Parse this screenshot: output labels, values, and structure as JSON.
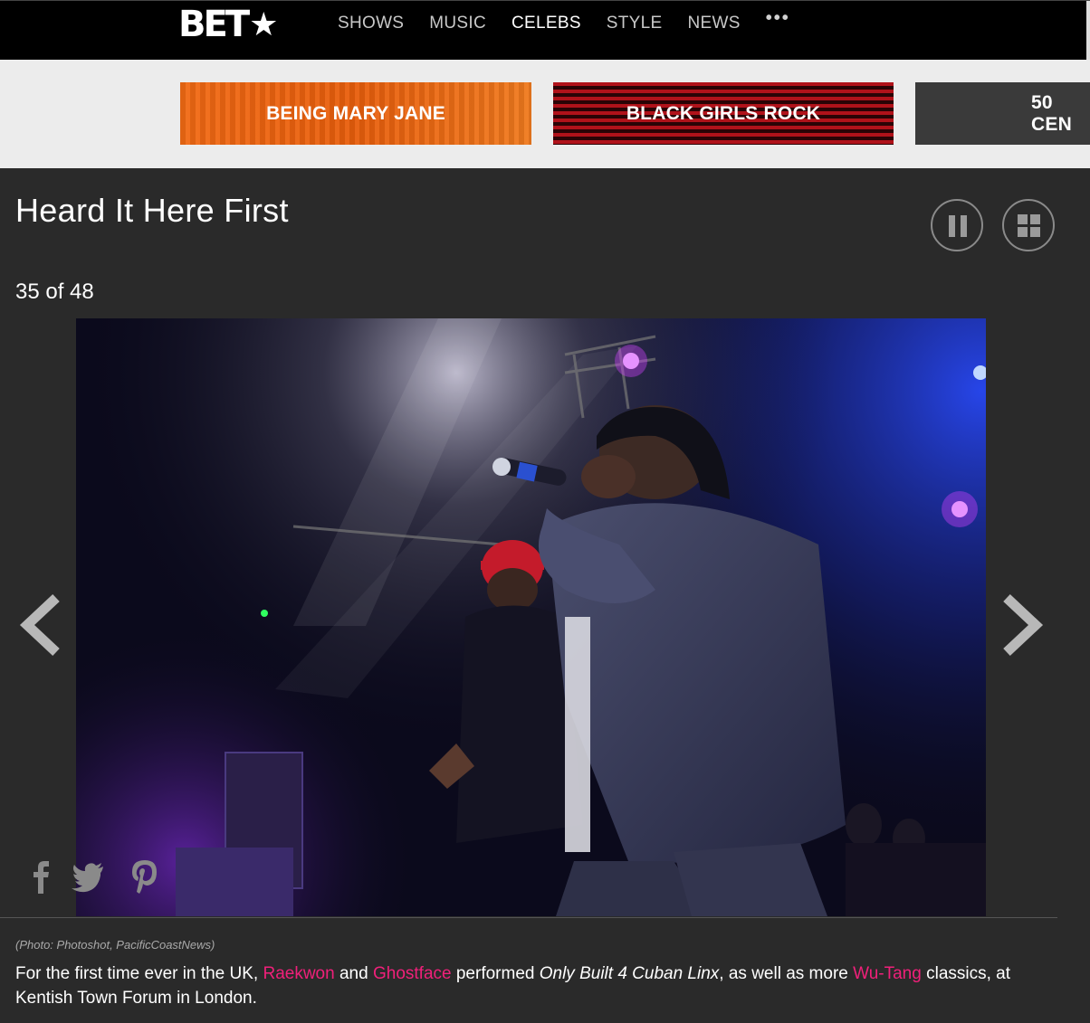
{
  "nav": {
    "logo": "BET",
    "items": [
      {
        "label": "SHOWS",
        "active": false
      },
      {
        "label": "MUSIC",
        "active": false
      },
      {
        "label": "CELEBS",
        "active": true
      },
      {
        "label": "STYLE",
        "active": false
      },
      {
        "label": "NEWS",
        "active": false
      }
    ],
    "more_label": "•••"
  },
  "promos": [
    {
      "label": "BEING MARY JANE",
      "color": "#f26a14"
    },
    {
      "label": "BLACK GIRLS ROCK",
      "color": "#b0121a"
    },
    {
      "label": "50 CEN"
    }
  ],
  "gallery": {
    "title": "Heard It Here First",
    "counter": "35 of 48",
    "controls": {
      "pause_icon": "pause-icon",
      "grid_icon": "grid-icon"
    }
  },
  "share": {
    "icons": [
      "facebook-icon",
      "twitter-icon",
      "pinterest-icon"
    ]
  },
  "credit": "(Photo: Photoshot, PacificCoastNews)",
  "caption": {
    "p1": "For the first time ever in the UK, ",
    "link1": "Raekwon",
    "p2": " and ",
    "link2": "Ghostface",
    "p3": " performed ",
    "em": "Only Built 4 Cuban Linx",
    "p4": ", as well as more ",
    "link3": "Wu-Tang",
    "p5": " classics, at Kentish Town Forum in London."
  },
  "colors": {
    "accent_link": "#f0207a",
    "nav_bg": "#000000",
    "page_bg": "#2a2a2a"
  }
}
